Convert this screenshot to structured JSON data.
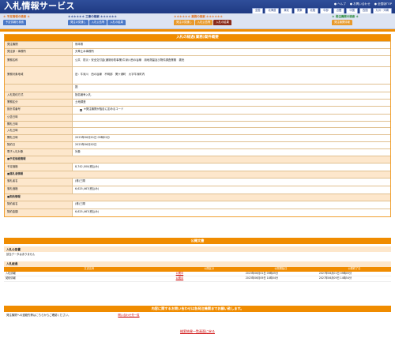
{
  "header": {
    "title": "入札情報サービス",
    "links": [
      "● ヘルプ",
      "● お問い合わせ",
      "● 全国版TOP"
    ],
    "regions": [
      "全国",
      "北海道",
      "東北",
      "関東",
      "北陸",
      "中部",
      "近畿",
      "中国",
      "四国",
      "九州・沖縄"
    ]
  },
  "nav": {
    "groups": [
      {
        "title": "＊ 予定情報の検索 ＊",
        "buttons": [
          "予定情報を検索"
        ]
      },
      {
        "title": "＊＊＊＊＊＊ 工事の検索 ＊＊＊＊＊＊",
        "buttons": [
          "発注の見通し",
          "入札公告等",
          "入札の結果"
        ]
      },
      {
        "title": "＊＊＊＊＊＊ 業務の検索 ＊＊＊＊＊＊",
        "buttons": [
          "発注の見通し",
          "入札公告等",
          "入札の結果"
        ]
      },
      {
        "title": "＊ 発注機関の検索 ＊",
        "buttons": [
          "発注機関情報"
        ]
      }
    ]
  },
  "detail": {
    "title": "入札の経過(業務)案件概要",
    "rows": [
      {
        "label": "発注機関",
        "value": "熊本県"
      },
      {
        "label": "発注部・事務所",
        "value": "天草土木事務所"
      },
      {
        "label": "業務名称",
        "value": "公共　防災・安全交付金(通常砂防事業)牛深川西の谷線　用地測量及び物件調査業務　委託"
      },
      {
        "label": "業務対象地域",
        "value": "旧：牛深川　西の谷線　不明部　関ケ浦町　大字牛深町内"
      },
      {
        "label": "",
        "value": "図"
      },
      {
        "label": "入札契約方式",
        "value": "指名競争入札"
      },
      {
        "label": "業務区分",
        "value": "土地調査"
      },
      {
        "label": "設計書番号",
        "value": "※発注機関が独自に定めるコード",
        "checkbox": true
      },
      {
        "label": "公告日時",
        "value": ""
      },
      {
        "label": "開札日時",
        "value": ""
      },
      {
        "label": "入札日時",
        "value": ""
      },
      {
        "label": "開札日時",
        "value": "2023年06月01日 09時02分"
      },
      {
        "label": "契約日",
        "value": "2023年06月02日"
      },
      {
        "label": "電子入札対象",
        "value": "対象"
      }
    ],
    "price_section": "■予定価格情報",
    "price_rows": [
      {
        "label": "予定価格",
        "value": "8,742,000(税込み)"
      }
    ],
    "award_section": "■落札者情報",
    "award_rows": [
      {
        "label": "落札者名",
        "value": "(株)三陽"
      },
      {
        "label": "落札価格",
        "value": "6,625,467(税込み)"
      }
    ],
    "contract_section": "■契約情報",
    "contract_rows": [
      {
        "label": "契約者名",
        "value": "(株)三陽"
      },
      {
        "label": "契約金額",
        "value": "6,625,467(税込み)"
      }
    ]
  },
  "notice": {
    "band": "公開文書",
    "sub1": "入札公告書",
    "sub1_text": "該当データはありません",
    "sub2": "入札経過",
    "columns": [
      "文書名称",
      "公開区分",
      "公開開始日",
      "公開終了日"
    ],
    "docs": [
      {
        "name": "入札情報",
        "link": "公開中",
        "start": "2023年06月01日 09時05分",
        "end": "2027年06月01日 09時05分"
      },
      {
        "name": "契約情報",
        "link": "公開中",
        "start": "2023年06月09日 14時54分",
        "end": "2027年06月09日 14時54分"
      }
    ]
  },
  "contact": {
    "band": "内容に関するお問い合わせは各発注機関までお願い致します。",
    "left": "発注機関への連絡先等はこちらからご確認ください。",
    "link": "問い合わせ先一覧"
  },
  "back": "検索結果一覧画面に戻る"
}
